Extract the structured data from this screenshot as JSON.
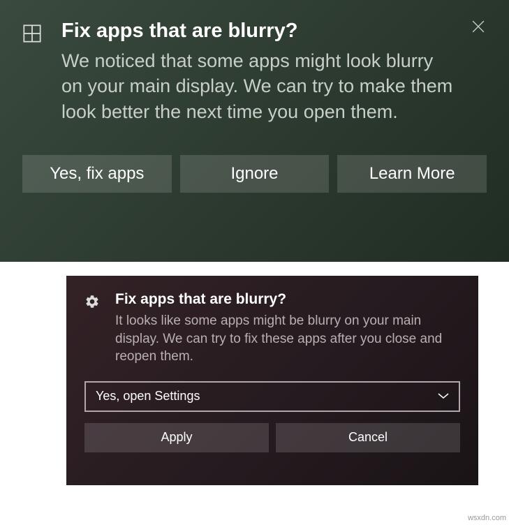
{
  "toast1": {
    "title": "Fix apps that are blurry?",
    "body": "We noticed that some apps might look blurry on your main display. We can try to make them look better the next time you open them.",
    "buttons": {
      "primary": "Yes, fix apps",
      "secondary": "Ignore",
      "tertiary": "Learn More"
    }
  },
  "toast2": {
    "title": "Fix apps that are blurry?",
    "body": "It looks like some apps might be blurry on your main display. We can try to fix these apps after you close and reopen them.",
    "dropdown": {
      "selected": "Yes, open Settings"
    },
    "buttons": {
      "apply": "Apply",
      "cancel": "Cancel"
    }
  },
  "watermark": "wsxdn.com"
}
